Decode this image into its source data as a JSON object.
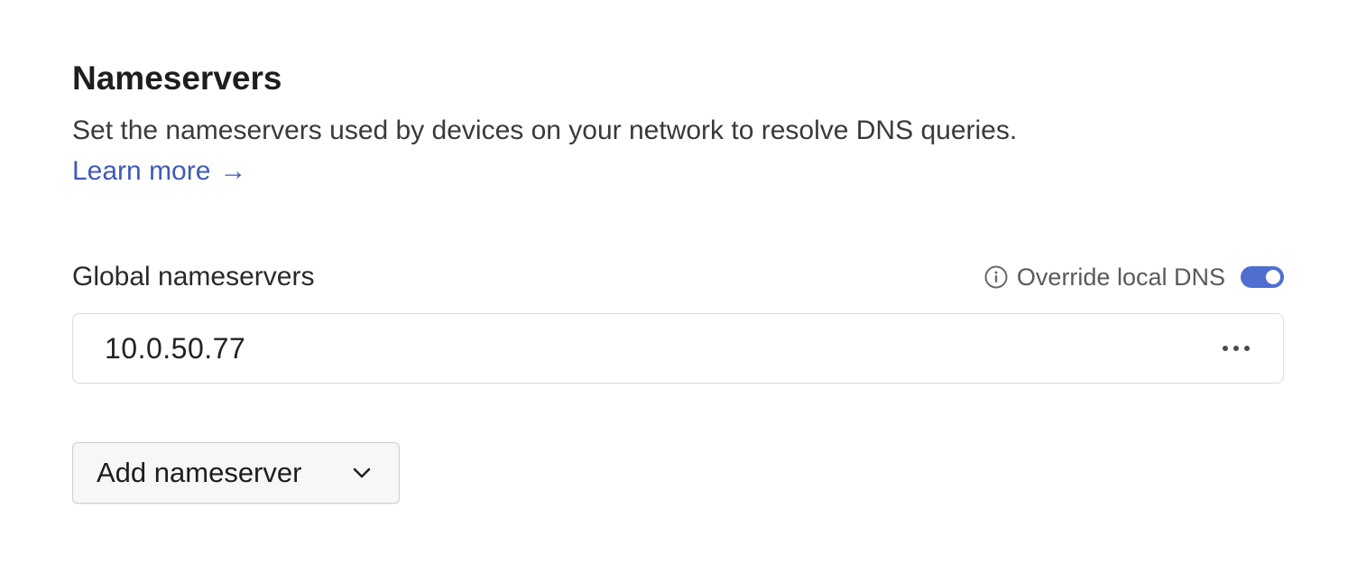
{
  "section": {
    "title": "Nameservers",
    "description": "Set the nameservers used by devices on your network to resolve DNS queries.",
    "learn_more": "Learn more",
    "learn_more_arrow": "→"
  },
  "global": {
    "label": "Global nameservers",
    "override_label": "Override local DNS",
    "override_enabled": true,
    "nameservers": [
      "10.0.50.77"
    ]
  },
  "add_button": {
    "label": "Add nameserver"
  },
  "colors": {
    "accent": "#4e6fcf",
    "link": "#3f5bb5"
  },
  "icons": {
    "info": "info-circle-icon",
    "more": "more-horizontal-icon",
    "chevron": "chevron-down-icon",
    "arrow": "arrow-right-icon"
  }
}
